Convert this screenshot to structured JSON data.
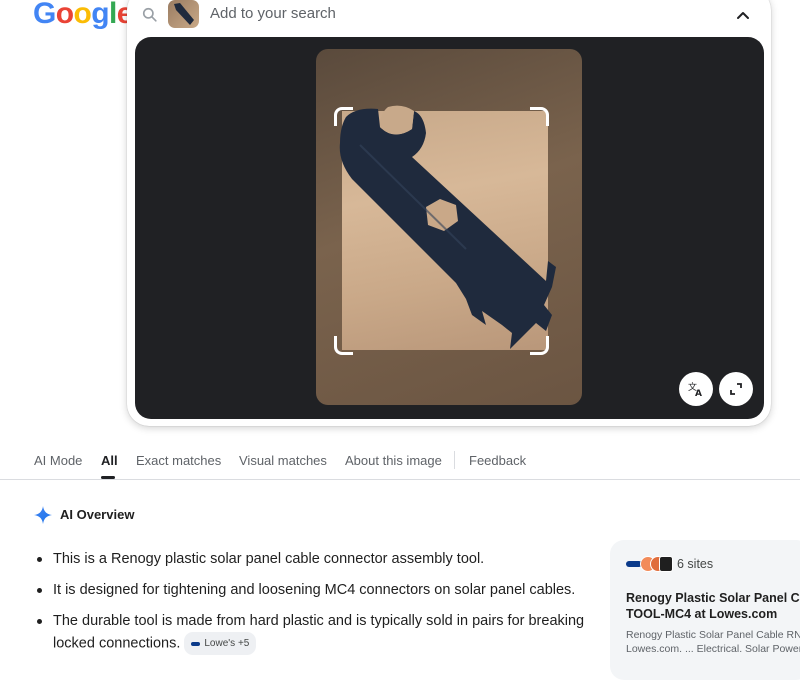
{
  "logo": {
    "letters": [
      "G",
      "o",
      "o",
      "g",
      "l",
      "e"
    ],
    "colors": [
      "#4285F4",
      "#EA4335",
      "#FBBC05",
      "#4285F4",
      "#34A853",
      "#EA4335"
    ]
  },
  "search": {
    "placeholder": "Add to your search"
  },
  "tabs": [
    {
      "label": "AI Mode"
    },
    {
      "label": "All",
      "active": true
    },
    {
      "label": "Exact matches"
    },
    {
      "label": "Visual matches"
    },
    {
      "label": "About this image"
    },
    {
      "label": "Feedback"
    }
  ],
  "ai_overview": {
    "title": "AI Overview",
    "bullets": [
      "This is a Renogy plastic solar panel cable connector assembly tool.",
      "It is designed for tightening and loosening MC4 connectors on solar panel cables.",
      "The durable tool is made from hard plastic and is typically sold in pairs for breaking locked connections."
    ],
    "chip": "Lowe's +5"
  },
  "sources": {
    "count": "6 sites",
    "title_line1": "Renogy Plastic Solar Panel Cab",
    "title_line2": "TOOL-MC4 at Lowes.com",
    "snippet_line1": "Renogy Plastic Solar Panel Cable RNG",
    "snippet_line2": "Lowes.com. ... Electrical. Solar Power."
  },
  "colors": {
    "accent": "#4285F4",
    "viewer_bg": "#202124",
    "tool": "#1f2a3d"
  }
}
